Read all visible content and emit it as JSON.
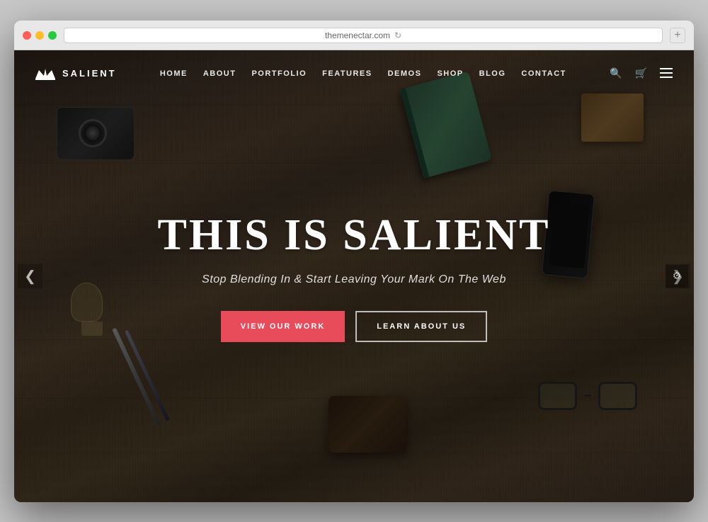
{
  "browser": {
    "url": "themenectar.com",
    "new_tab_label": "+"
  },
  "logo": {
    "text": "SALIENT"
  },
  "nav": {
    "links": [
      {
        "label": "HOME",
        "id": "home"
      },
      {
        "label": "ABOUT",
        "id": "about"
      },
      {
        "label": "PORTFOLIO",
        "id": "portfolio"
      },
      {
        "label": "FEATURES",
        "id": "features"
      },
      {
        "label": "DEMOS",
        "id": "demos"
      },
      {
        "label": "SHOP",
        "id": "shop"
      },
      {
        "label": "BLOG",
        "id": "blog"
      },
      {
        "label": "CONTACT",
        "id": "contact"
      }
    ]
  },
  "hero": {
    "title": "THIS IS SALIENT",
    "subtitle": "Stop Blending In & Start Leaving Your Mark On The Web",
    "btn_primary": "VIEW OUR WORK",
    "btn_secondary": "LEARN ABOUT US"
  },
  "slider": {
    "arrow_left": "❮",
    "arrow_right": "❯"
  },
  "settings": {
    "icon": "⚙"
  }
}
